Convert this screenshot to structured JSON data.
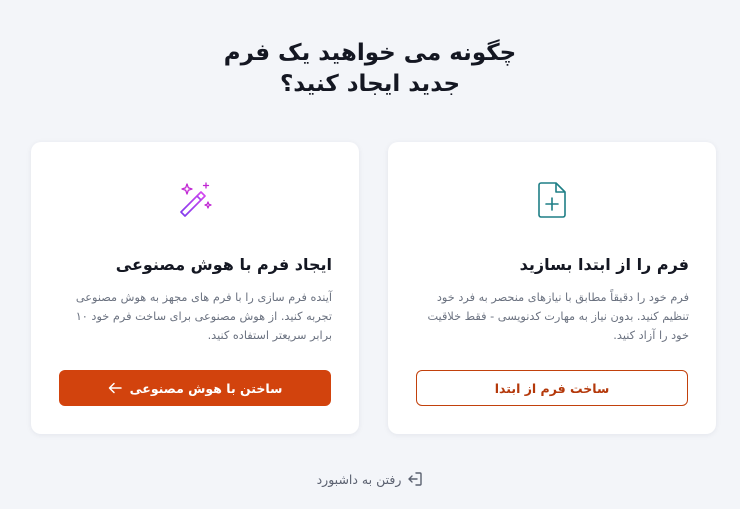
{
  "header": {
    "title_line1": "چگونه می خواهید یک فرم",
    "title_line2": "جدید ایجاد کنید؟"
  },
  "cards": [
    {
      "icon": "document-plus-icon",
      "title": "فرم را از ابتدا بسازید",
      "description": "فرم خود را دقیقاً مطابق با نیازهای منحصر به فرد خود تنظیم کنید. بدون نیاز به مهارت کدنویسی - فقط خلاقیت خود را آزاد کنید.",
      "button_label": "ساخت فرم از ابتدا"
    },
    {
      "icon": "magic-wand-icon",
      "title": "ایجاد فرم با هوش مصنوعی",
      "description": "آینده فرم سازی را با فرم های مجهز به هوش مصنوعی تجربه کنید. از هوش مصنوعی برای ساخت فرم خود ۱۰ برابر سریعتر استفاده کنید.",
      "button_label": "ساختن با هوش مصنوعی",
      "button_icon": "arrow-left-icon"
    }
  ],
  "footer": {
    "dashboard_link": "رفتن به داشبورد",
    "dashboard_icon": "exit-icon"
  },
  "colors": {
    "accent": "#d2430d",
    "background": "#f3f5f9",
    "icon_teal": "#1f7f86",
    "icon_purple": "#b33ad1"
  }
}
